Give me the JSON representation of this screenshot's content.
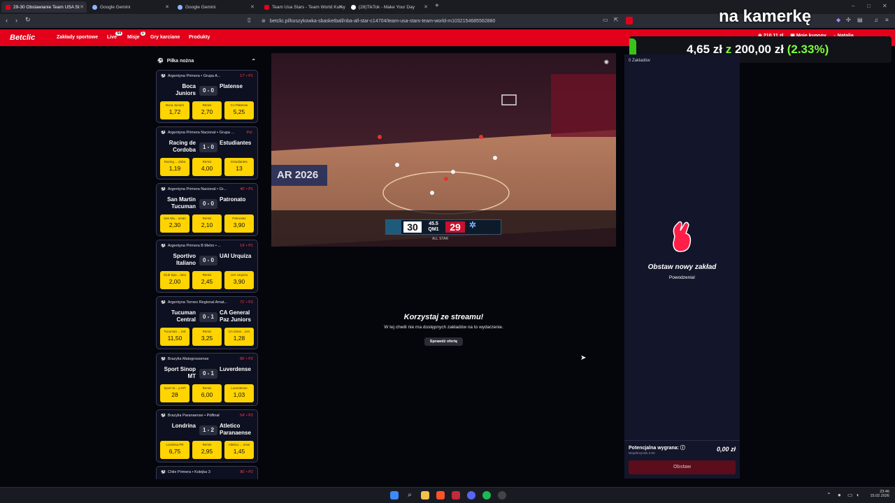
{
  "browser": {
    "tabs": [
      {
        "title": "29-30 Obstawianie Team USA St",
        "favicon_color": "#e2001a",
        "active": true
      },
      {
        "title": "Google Gemini",
        "favicon_color": "#8fb4ff",
        "active": false
      },
      {
        "title": "Google Gemini",
        "favicon_color": "#8fb4ff",
        "active": false
      },
      {
        "title": "Team Usa Stars - Team World Kursy",
        "favicon_color": "#e2001a",
        "active": false
      },
      {
        "title": "(28)TikTok - Make Your Day",
        "favicon_color": "#ffffff",
        "active": false
      }
    ],
    "new_tab": "+",
    "url": "betclic.pl/koszykowka-sbasketball/nba-all-star-c14704/team-usa-stars-team-world-m1032154685562880"
  },
  "overlay": {
    "camera_text": "na kamerkę",
    "stat_amount": "4,65 zł",
    "stat_of": "z",
    "stat_total": "200,00 zł",
    "stat_percent": "(2.33%)"
  },
  "nav": {
    "brand": "Betclic",
    "items": [
      {
        "label": "Zakłady sportowe",
        "badge": ""
      },
      {
        "label": "Live",
        "badge": "54"
      },
      {
        "label": "Misje",
        "badge": "1"
      },
      {
        "label": "Gry karciane",
        "badge": ""
      },
      {
        "label": "Produkty",
        "badge": ""
      }
    ],
    "balance": "210,11 zł",
    "my_coupons": "Moje kupony",
    "user": "Natalia"
  },
  "sidebar": {
    "section_title": "Piłka nożna",
    "matches": [
      {
        "league": "Argentyna Primera • Grupa A...",
        "time": "17' • P1",
        "home": "Boca Juniors",
        "score": "0 - 0",
        "away": "Platense",
        "odds": [
          {
            "label": "Boca Juniors",
            "value": "1,72"
          },
          {
            "label": "Remis",
            "value": "2,70"
          },
          {
            "label": "CA Platense",
            "value": "5,25"
          }
        ]
      },
      {
        "league": "Argentyna Primera Nacional • Grupa ...",
        "time": "Pol.",
        "home": "Racing de Cordoba",
        "score": "1 - 0",
        "away": "Estudiantes",
        "odds": [
          {
            "label": "Racing ... doba",
            "value": "1,19"
          },
          {
            "label": "Remis",
            "value": "4,00"
          },
          {
            "label": "Estudiantes",
            "value": "13"
          }
        ]
      },
      {
        "league": "Argentyna Primera Nacional • Gr...",
        "time": "40' • P1",
        "home": "San Martin Tucuman",
        "score": "0 - 0",
        "away": "Patronato",
        "odds": [
          {
            "label": "San Ma... uman",
            "value": "2,30"
          },
          {
            "label": "Remis",
            "value": "2,10"
          },
          {
            "label": "Patronato",
            "value": "3,90"
          }
        ]
      },
      {
        "league": "Argentyna Primera B Metro • ...",
        "time": "14' • P1",
        "home": "Sportivo Italiano",
        "score": "0 - 0",
        "away": "UAI Urquiza",
        "odds": [
          {
            "label": "Club Spo... iano",
            "value": "2,00"
          },
          {
            "label": "Remis",
            "value": "2,45"
          },
          {
            "label": "UAI Urquiza",
            "value": "3,90"
          }
        ]
      },
      {
        "league": "Argentyna Torneo Regional Amat...",
        "time": "71' • P2",
        "home": "Tucuman Central",
        "score": "0 - 1",
        "away": "CA General Paz Juniors",
        "odds": [
          {
            "label": "Tucuman ... tral",
            "value": "11,50"
          },
          {
            "label": "Remis",
            "value": "3,25"
          },
          {
            "label": "CA Gene... iors",
            "value": "1,28"
          }
        ]
      },
      {
        "league": "Brazylia Matogrossense",
        "time": "86' • P2",
        "home": "Sport Sinop MT",
        "score": "0 - 1",
        "away": "Luverdense",
        "odds": [
          {
            "label": "Sport Si... p MT",
            "value": "28"
          },
          {
            "label": "Remis",
            "value": "6,00"
          },
          {
            "label": "Luverdense",
            "value": "1,03"
          }
        ]
      },
      {
        "league": "Brazylia Paranaense • Półfinał",
        "time": "54' • P2",
        "home": "Londrina",
        "score": "1 - 2",
        "away": "Atletico Paranaense",
        "odds": [
          {
            "label": "Londrina PR",
            "value": "6,75"
          },
          {
            "label": "Remis",
            "value": "2,95"
          },
          {
            "label": "Atletico ... ense",
            "value": "1,45"
          }
        ]
      },
      {
        "league": "Chile Primera • Kolejka 3",
        "time": "86' • P2",
        "home": "",
        "score": "",
        "away": "",
        "odds": []
      }
    ]
  },
  "stream": {
    "banner_text": "AR 2026",
    "score_home": "30",
    "clock": "45.5",
    "quarter": "QM1",
    "score_away": "29",
    "event_tag": "ALL STAR"
  },
  "center": {
    "headline": "Korzystaj ze streamu!",
    "subtext": "W tej chwili nie ma dostępnych zakładów na to wydarzenie.",
    "button": "Sprawdź ofertę"
  },
  "betslip": {
    "header": "0 Zakładów",
    "empty_title": "Obstaw nowy zakład",
    "empty_sub": "Powodzenia!",
    "potential_label": "Potencjalna wygrana:",
    "coefficient": "Współczynnik 0.00",
    "potential_value": "0,00 zł",
    "place_button": "Obstaw"
  },
  "taskbar": {
    "time": "23:46",
    "date": "15.02.2026"
  },
  "colors": {
    "brand_red": "#e2001a",
    "odds_yellow": "#ffd400",
    "live_red": "#ff3b4e",
    "stat_green": "#7dff3a"
  }
}
